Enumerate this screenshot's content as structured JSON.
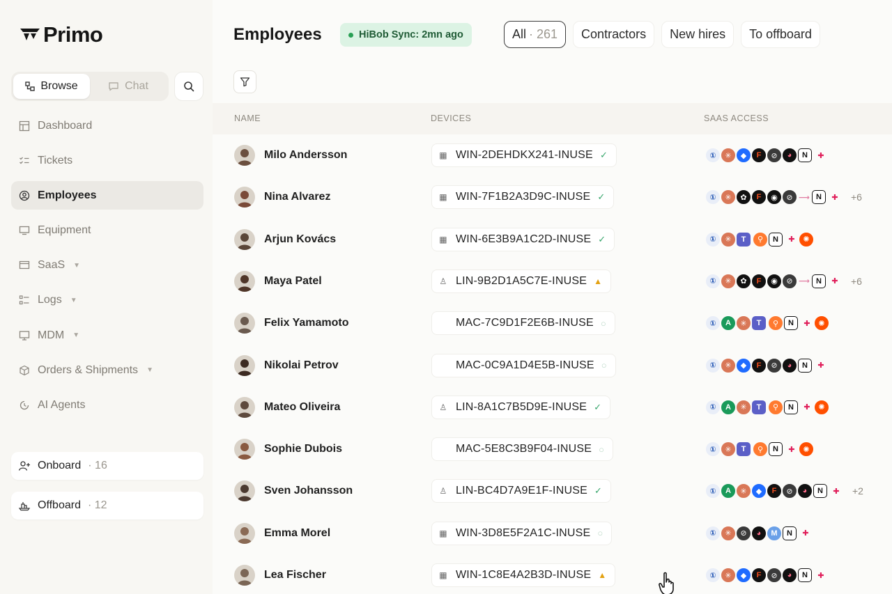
{
  "app": {
    "brand": "Primo"
  },
  "sidebar": {
    "mode": {
      "browse": "Browse",
      "chat": "Chat"
    },
    "items": [
      {
        "label": "Dashboard",
        "icon": "dashboard-icon",
        "active": false,
        "caret": false
      },
      {
        "label": "Tickets",
        "icon": "tickets-icon",
        "active": false,
        "caret": false
      },
      {
        "label": "Employees",
        "icon": "employees-icon",
        "active": true,
        "caret": false
      },
      {
        "label": "Equipment",
        "icon": "equipment-icon",
        "active": false,
        "caret": false
      },
      {
        "label": "SaaS",
        "icon": "saas-icon",
        "active": false,
        "caret": true
      },
      {
        "label": "Logs",
        "icon": "logs-icon",
        "active": false,
        "caret": true
      },
      {
        "label": "MDM",
        "icon": "mdm-icon",
        "active": false,
        "caret": true
      },
      {
        "label": "Orders & Shipments",
        "icon": "orders-icon",
        "active": false,
        "caret": true
      },
      {
        "label": "AI Agents",
        "icon": "ai-agents-icon",
        "active": false,
        "caret": false
      }
    ],
    "onboard": {
      "label": "Onboard",
      "count": "· 16"
    },
    "offboard": {
      "label": "Offboard",
      "count": "· 12"
    }
  },
  "header": {
    "title": "Employees",
    "sync": "HiBob Sync: 2mn ago",
    "tabs": [
      {
        "label": "All",
        "count": "· 261",
        "active": true
      },
      {
        "label": "Contractors",
        "count": "",
        "active": false
      },
      {
        "label": "New hires",
        "count": "",
        "active": false
      },
      {
        "label": "To offboard",
        "count": "",
        "active": false
      }
    ]
  },
  "table": {
    "columns": {
      "name": "NAME",
      "devices": "DEVICES",
      "saas": "SAAS ACCESS"
    },
    "rows": [
      {
        "name": "Milo Andersson",
        "os": "win",
        "device": "WIN-2DEHDKX241-INUSE",
        "status": "ok",
        "apps": [
          "1password",
          "claude",
          "dropbox",
          "figma",
          "linear",
          "loom",
          "notion",
          "slack"
        ],
        "more": ""
      },
      {
        "name": "Nina Alvarez",
        "os": "win",
        "device": "WIN-7F1B2A3D9C-INUSE",
        "status": "ok",
        "apps": [
          "1password",
          "claude",
          "openai",
          "figma",
          "github",
          "linear",
          "link",
          "notion",
          "slack"
        ],
        "more": "+6"
      },
      {
        "name": "Arjun Kovács",
        "os": "win",
        "device": "WIN-6E3B9A1C2D-INUSE",
        "status": "ok",
        "apps": [
          "1password",
          "claude",
          "teams",
          "hubspot",
          "notion",
          "slack",
          "zapier"
        ],
        "more": ""
      },
      {
        "name": "Maya Patel",
        "os": "linux",
        "device": "LIN-9B2D1A5C7E-INUSE",
        "status": "warn",
        "apps": [
          "1password",
          "claude",
          "openai",
          "figma",
          "github",
          "linear",
          "link",
          "notion",
          "slack"
        ],
        "more": "+6"
      },
      {
        "name": "Felix Yamamoto",
        "os": "mac",
        "device": "MAC-7C9D1F2E6B-INUSE",
        "status": "pending",
        "apps": [
          "1password",
          "anthropic",
          "claude",
          "teams",
          "hubspot",
          "notion",
          "slack",
          "zapier"
        ],
        "more": ""
      },
      {
        "name": "Nikolai Petrov",
        "os": "mac",
        "device": "MAC-0C9A1D4E5B-INUSE",
        "status": "pending",
        "apps": [
          "1password",
          "claude",
          "dropbox",
          "figma",
          "linear",
          "loom",
          "notion",
          "slack"
        ],
        "more": ""
      },
      {
        "name": "Mateo Oliveira",
        "os": "linux",
        "device": "LIN-8A1C7B5D9E-INUSE",
        "status": "ok",
        "apps": [
          "1password",
          "anthropic",
          "claude",
          "teams",
          "hubspot",
          "notion",
          "slack",
          "zapier"
        ],
        "more": ""
      },
      {
        "name": "Sophie Dubois",
        "os": "mac",
        "device": "MAC-5E8C3B9F04-INUSE",
        "status": "pending",
        "apps": [
          "1password",
          "claude",
          "teams",
          "hubspot",
          "notion",
          "slack",
          "zapier"
        ],
        "more": ""
      },
      {
        "name": "Sven Johansson",
        "os": "linux",
        "device": "LIN-BC4D7A9E1F-INUSE",
        "status": "ok",
        "apps": [
          "1password",
          "anthropic",
          "claude",
          "dropbox",
          "figma",
          "linear",
          "loom",
          "notion",
          "slack"
        ],
        "more": "+2"
      },
      {
        "name": "Emma Morel",
        "os": "win",
        "device": "WIN-3D8E5F2A1C-INUSE",
        "status": "pending",
        "apps": [
          "1password",
          "claude",
          "linear",
          "loom",
          "gmail",
          "notion",
          "slack"
        ],
        "more": ""
      },
      {
        "name": "Lea Fischer",
        "os": "win",
        "device": "WIN-1C8E4A2B3D-INUSE",
        "status": "warn",
        "apps": [
          "1password",
          "claude",
          "dropbox",
          "figma",
          "linear",
          "loom",
          "notion",
          "slack"
        ],
        "more": ""
      }
    ]
  },
  "colors": {
    "accent_green": "#2aa055",
    "sync_bg": "#dcf3e4",
    "claude": "#d97757",
    "dropbox": "#1f6bff",
    "hubspot": "#ff7a2f",
    "zapier": "#ff4f00"
  }
}
